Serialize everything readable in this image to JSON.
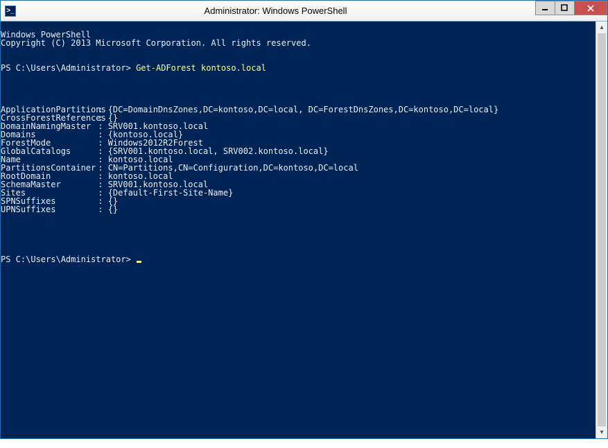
{
  "window": {
    "title": "Administrator: Windows PowerShell",
    "icon_glyph": ">_"
  },
  "banner": {
    "line1": "Windows PowerShell",
    "line2": "Copyright (C) 2013 Microsoft Corporation. All rights reserved."
  },
  "prompt": "PS C:\\Users\\Administrator> ",
  "command": "Get-ADForest kontoso.local",
  "output": [
    {
      "key": "ApplicationPartitions",
      "value": "{DC=DomainDnsZones,DC=kontoso,DC=local, DC=ForestDnsZones,DC=kontoso,DC=local}"
    },
    {
      "key": "CrossForestReferences",
      "value": "{}"
    },
    {
      "key": "DomainNamingMaster",
      "value": "SRV001.kontoso.local"
    },
    {
      "key": "Domains",
      "value": "{kontoso.local}"
    },
    {
      "key": "ForestMode",
      "value": "Windows2012R2Forest"
    },
    {
      "key": "GlobalCatalogs",
      "value": "{SRV001.kontoso.local, SRV002.kontoso.local}"
    },
    {
      "key": "Name",
      "value": "kontoso.local"
    },
    {
      "key": "PartitionsContainer",
      "value": "CN=Partitions,CN=Configuration,DC=kontoso,DC=local"
    },
    {
      "key": "RootDomain",
      "value": "kontoso.local"
    },
    {
      "key": "SchemaMaster",
      "value": "SRV001.kontoso.local"
    },
    {
      "key": "Sites",
      "value": "{Default-First-Site-Name}"
    },
    {
      "key": "SPNSuffixes",
      "value": "{}"
    },
    {
      "key": "UPNSuffixes",
      "value": "{}"
    }
  ],
  "kv_separator": " : "
}
